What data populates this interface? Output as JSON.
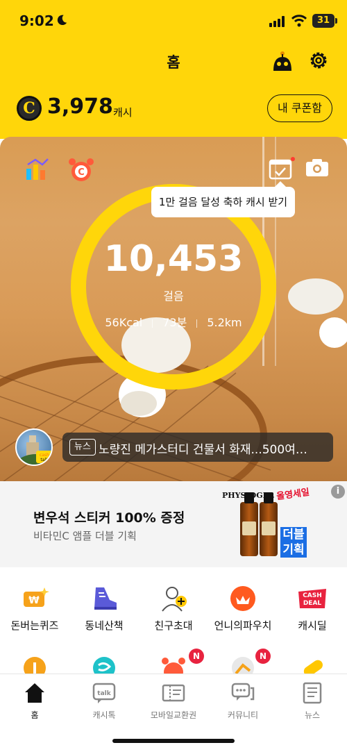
{
  "status_bar": {
    "time": "9:02",
    "battery": "31"
  },
  "header": {
    "title": "홈"
  },
  "cash": {
    "amount": "3,978",
    "unit": "캐시",
    "coupon_button": "내 쿠폰함"
  },
  "hero": {
    "tooltip": "1만 걸음 달성 축하 캐시 받기",
    "steps": "10,453",
    "steps_label": "걸음",
    "calories": "56Kcal",
    "minutes": "73분",
    "distance": "5.2km",
    "ring_progress": 1.0,
    "news_tag": "뉴스",
    "news_headline": "노량진 메가스터디 건물서 화재...500여…",
    "news_avatar_text": "cash talk"
  },
  "ad": {
    "title": "변우석 스티커 100% 증정",
    "subtitle": "비타민C 앰플 더블 기획",
    "brand": "PHYSIOGEL",
    "badge": "올영세일",
    "ribbon": "더블 기획",
    "info": "i"
  },
  "menu": [
    {
      "label": "돈버는퀴즈",
      "icon": "quiz-money-icon"
    },
    {
      "label": "동네산책",
      "icon": "sneaker-icon"
    },
    {
      "label": "친구초대",
      "icon": "invite-friend-icon"
    },
    {
      "label": "언니의파우치",
      "icon": "pouch-icon"
    },
    {
      "label": "캐시딜",
      "icon": "cash-deal-icon",
      "badge_text": "CASH DEAL"
    }
  ],
  "menu_row2_badges": [
    "N",
    "N"
  ],
  "tabbar": [
    {
      "label": "홈",
      "active": true
    },
    {
      "label": "캐시톡",
      "active": false
    },
    {
      "label": "모바일교환권",
      "active": false
    },
    {
      "label": "커뮤니티",
      "active": false
    },
    {
      "label": "뉴스",
      "active": false
    }
  ],
  "colors": {
    "accent": "#FFD60A",
    "badge": "#e8233f",
    "pouch": "#ff5a1f"
  }
}
